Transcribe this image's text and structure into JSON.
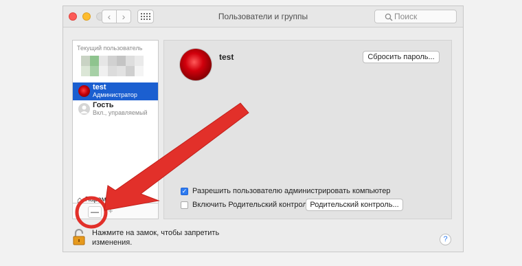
{
  "window": {
    "title": "Пользователи и группы",
    "back_glyph": "‹",
    "forward_glyph": "›",
    "search_placeholder": "Поиск"
  },
  "sidebar": {
    "heading": "Текущий пользователь",
    "users": [
      {
        "name": "test",
        "role": "Администратор",
        "selected": true
      },
      {
        "name": "Гость",
        "role": "Вкл., управляемый",
        "selected": false
      }
    ],
    "login_options_label": "Параметры входа",
    "remove_label": "—",
    "add_label": "+"
  },
  "detail": {
    "user_name": "test",
    "reset_password_label": "Сбросить пароль...",
    "allow_admin_label": "Разрешить пользователю администрировать компьютер",
    "allow_admin_checked": true,
    "parental_controls_label": "Включить Родительский контроль",
    "parental_controls_checked": false,
    "open_parental_label": "Родительский контроль..."
  },
  "footer": {
    "lock_text_line1": "Нажмите на замок, чтобы запретить",
    "lock_text_line2": "изменения.",
    "help_label": "?"
  },
  "annotation": {
    "arrow_color": "#e2302a",
    "circle_color": "#e2302a"
  }
}
